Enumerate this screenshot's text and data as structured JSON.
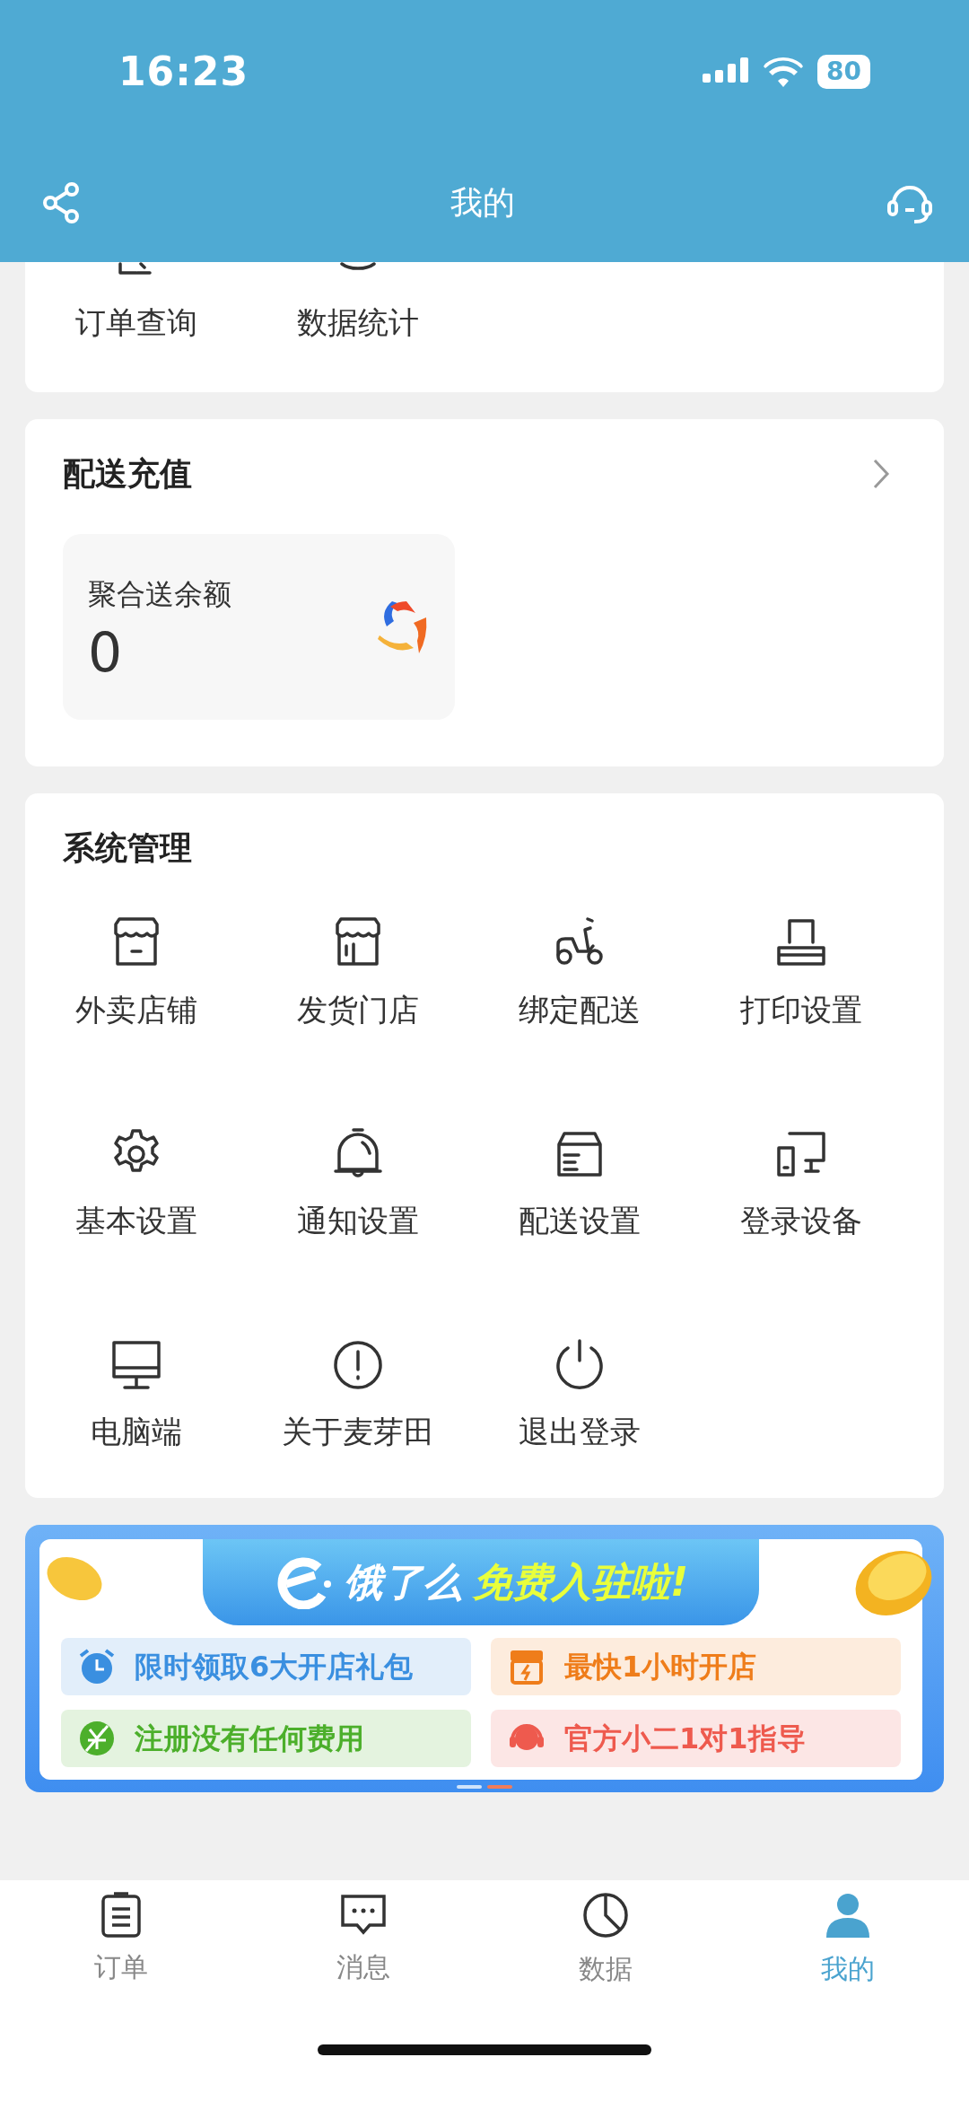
{
  "status_bar": {
    "time": "16:23",
    "battery": "80"
  },
  "header": {
    "title": "我的"
  },
  "top_tools": [
    {
      "label": "订单查询"
    },
    {
      "label": "数据统计"
    }
  ],
  "recharge": {
    "title": "配送充值",
    "balance_label": "聚合送余额",
    "balance": "0"
  },
  "system": {
    "title": "系统管理",
    "items": [
      {
        "label": "外卖店铺"
      },
      {
        "label": "发货门店"
      },
      {
        "label": "绑定配送"
      },
      {
        "label": "打印设置"
      },
      {
        "label": "基本设置"
      },
      {
        "label": "通知设置"
      },
      {
        "label": "配送设置"
      },
      {
        "label": "登录设备"
      },
      {
        "label": "电脑端"
      },
      {
        "label": "关于麦芽田"
      },
      {
        "label": "退出登录"
      }
    ]
  },
  "banner": {
    "title_part1": "饿了么",
    "title_part2": "免费入驻啦!",
    "perks": [
      {
        "text": "限时领取6大开店礼包",
        "color": "#3a8fe0"
      },
      {
        "text": "最快1小时开店",
        "color": "#ef7d1a"
      },
      {
        "text": "注册没有任何费用",
        "color": "#4caf2b"
      },
      {
        "text": "官方小二1对1指导",
        "color": "#ee5a4e"
      }
    ],
    "pages": [
      {
        "selected": false
      },
      {
        "selected": true
      }
    ]
  },
  "tab_bar": [
    {
      "label": "订单",
      "selected": false
    },
    {
      "label": "消息",
      "selected": false
    },
    {
      "label": "数据",
      "selected": false
    },
    {
      "label": "我的",
      "selected": true
    }
  ]
}
